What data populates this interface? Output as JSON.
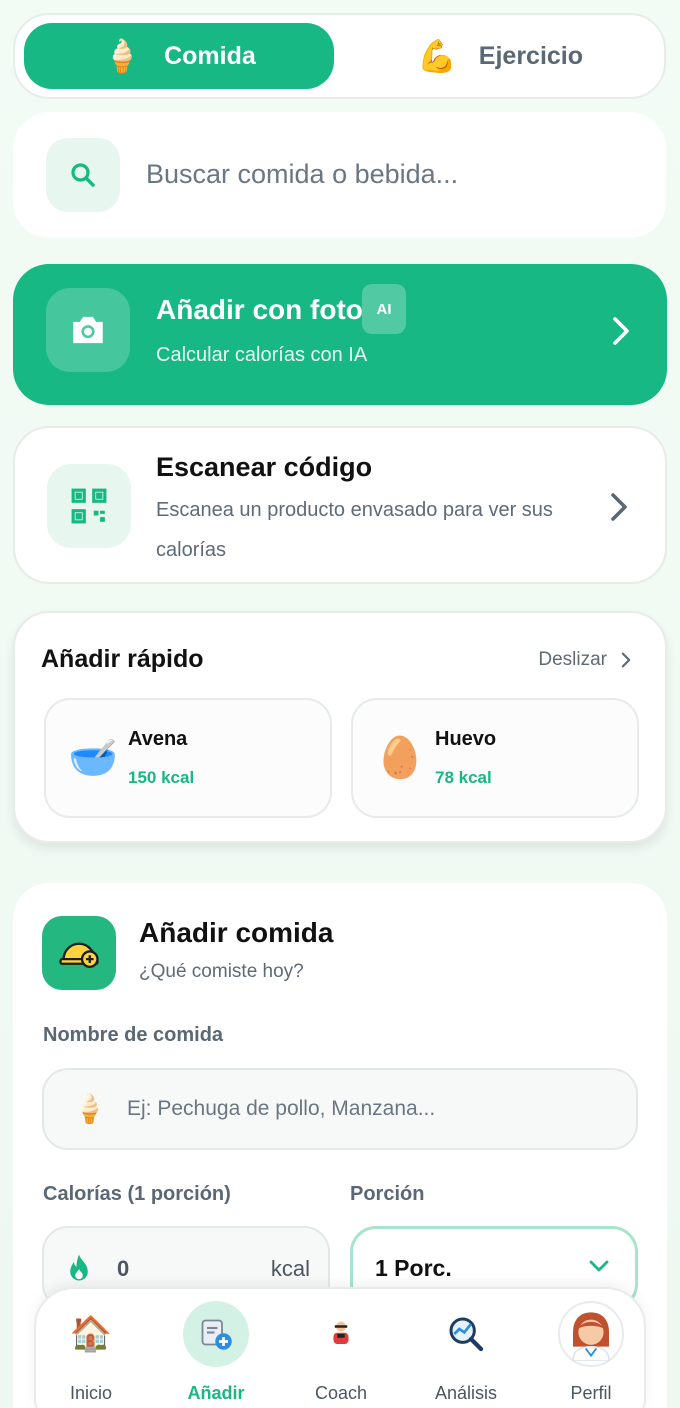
{
  "tabs": {
    "food_label": "Comida",
    "food_icon": "ice-cream-icon",
    "exercise_label": "Ejercicio",
    "exercise_icon": "flexed-biceps-icon"
  },
  "search": {
    "placeholder": "Buscar comida o bebida..."
  },
  "photo_card": {
    "title": "Añadir con foto",
    "badge": "AI",
    "subtitle": "Calcular calorías con IA"
  },
  "scan_card": {
    "title": "Escanear código",
    "subtitle": "Escanea un producto envasado para ver sus calorías"
  },
  "quick_add": {
    "title": "Añadir rápido",
    "swipe_label": "Deslizar",
    "items": [
      {
        "name": "Avena",
        "kcal": "150 kcal",
        "icon": "bowl-icon"
      },
      {
        "name": "Huevo",
        "kcal": "78 kcal",
        "icon": "egg-icon"
      }
    ]
  },
  "add_meal": {
    "title": "Añadir comida",
    "subtitle": "¿Qué comiste hoy?",
    "name_label": "Nombre de comida",
    "name_placeholder": "Ej: Pechuga de pollo, Manzana...",
    "calories_label": "Calorías (1 porción)",
    "calories_value": "0",
    "calories_unit": "kcal",
    "portion_label": "Porción",
    "portion_value": "1 Porc."
  },
  "nav": {
    "items": [
      {
        "label": "Inicio",
        "icon": "house-icon"
      },
      {
        "label": "Añadir",
        "icon": "add-note-icon"
      },
      {
        "label": "Coach",
        "icon": "coach-icon"
      },
      {
        "label": "Análisis",
        "icon": "analysis-icon"
      },
      {
        "label": "Perfil",
        "icon": "doctor-avatar-icon"
      }
    ],
    "active": "Añadir"
  },
  "colors": {
    "accent": "#17b884",
    "accent_light": "#e8f6f0",
    "text_muted": "#5e6b77"
  }
}
